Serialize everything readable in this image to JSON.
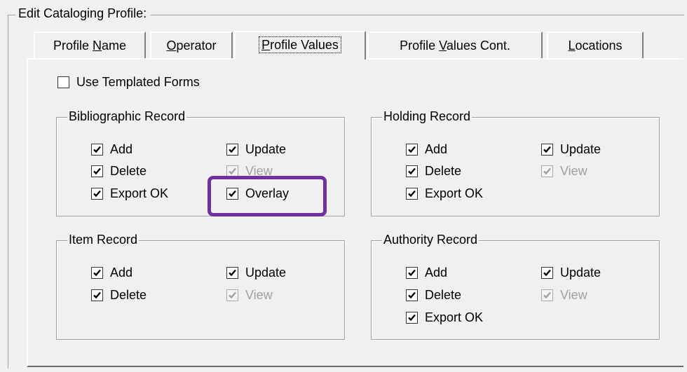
{
  "frame": {
    "title": "Edit Cataloging Profile:"
  },
  "tabs": [
    {
      "pre": "Profile ",
      "key": "N",
      "post": "ame"
    },
    {
      "pre": "",
      "key": "O",
      "post": "perator"
    },
    {
      "pre": "",
      "key": "P",
      "post": "rofile Values"
    },
    {
      "pre": "Profile ",
      "key": "V",
      "post": "alues Cont."
    },
    {
      "pre": "",
      "key": "L",
      "post": "ocations"
    }
  ],
  "active_tab": "Profile Values",
  "use_templated": {
    "label": "Use Templated Forms",
    "checked": false
  },
  "groups": {
    "bib": {
      "title": "Bibliographic Record",
      "add": "Add",
      "delete": "Delete",
      "export": "Export OK",
      "update": "Update",
      "view": "View",
      "overlay": "Overlay"
    },
    "holding": {
      "title": "Holding Record",
      "add": "Add",
      "delete": "Delete",
      "export": "Export OK",
      "update": "Update",
      "view": "View"
    },
    "item": {
      "title": "Item Record",
      "add": "Add",
      "delete": "Delete",
      "update": "Update",
      "view": "View"
    },
    "authority": {
      "title": "Authority Record",
      "add": "Add",
      "delete": "Delete",
      "export": "Export OK",
      "update": "Update",
      "view": "View"
    }
  },
  "colors": {
    "highlight": "#7030a0",
    "disabled_text": "#a0a0a0"
  }
}
